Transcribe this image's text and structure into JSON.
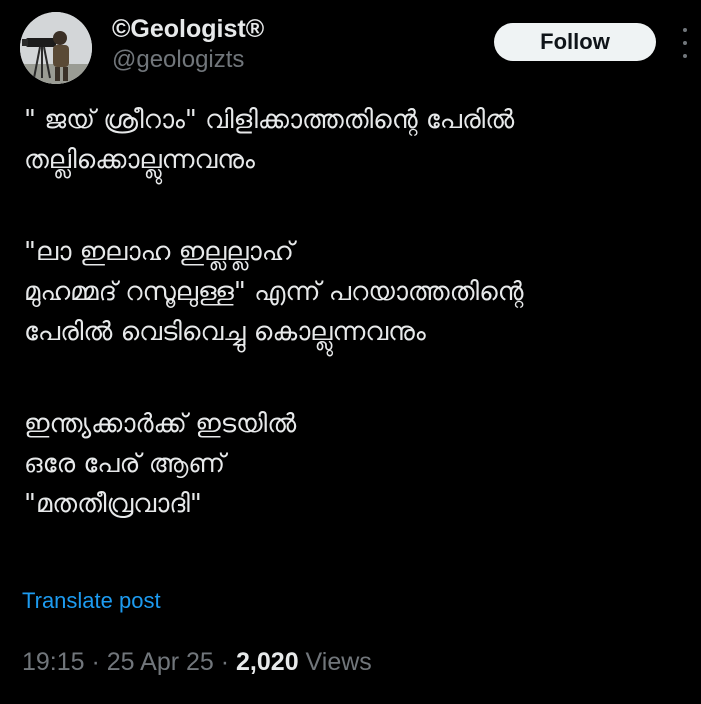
{
  "author": {
    "display_name": "©Geologist®",
    "handle": "@geologizts"
  },
  "actions": {
    "follow_label": "Follow",
    "more_icon": "more-vertical-icon"
  },
  "tweet": {
    "lines": [
      "\" ജയ് ശ്രീറാം\" വിളിക്കാത്തതിന്റെ പേരിൽ",
      "തല്ലിക്കൊല്ലുന്നവനും",
      "\"ലാ ഇലാഹ ഇല്ലല്ലാഹ്",
      "മുഹമ്മദ് റസൂലുള്ള\" എന്ന് പറയാത്തതിന്റെ",
      "പേരിൽ വെടിവെച്ചു കൊല്ലുന്നവനും",
      "ഇന്ത്യക്കാർക്ക് ഇടയിൽ",
      " ഒരേ പേര് ആണ്",
      "\"മതതീവ്രവാദി\""
    ]
  },
  "translate_label": "Translate post",
  "meta": {
    "time": "19:15",
    "separator": " · ",
    "date": "25 Apr 25",
    "views_count": "2,020",
    "views_label": " Views"
  },
  "colors": {
    "background": "#000000",
    "text": "#e7e9ea",
    "muted": "#71767b",
    "link": "#1d9bf0",
    "button_bg": "#eff3f4"
  }
}
